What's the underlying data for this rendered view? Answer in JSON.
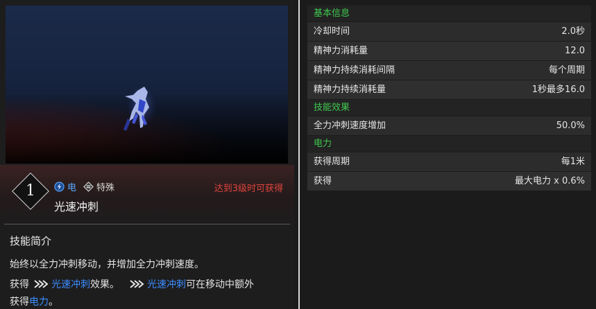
{
  "skill": {
    "level": "1",
    "tags": [
      {
        "label": "电",
        "icon": "lightning-icon",
        "color": "#5aa9ff"
      },
      {
        "label": "特殊",
        "icon": "special-icon"
      }
    ],
    "name": "光速冲刺",
    "unlock_text": "达到3级时可获得"
  },
  "intro": {
    "title": "技能简介",
    "line1": "始终以全力冲刺移动，并增加全力冲刺速度。",
    "line2_prefix": "获得",
    "line2_link1": "光速冲刺",
    "line2_mid": "效果。",
    "line2_link2": "光速冲刺",
    "line2_suffix": "可在移动中额外",
    "line3_prefix": "获得",
    "line3_link": "电力",
    "line3_suffix": "。"
  },
  "sections": [
    {
      "title": "基本信息",
      "rows": [
        {
          "label": "冷却时间",
          "value": "2.0秒"
        },
        {
          "label": "精神力消耗量",
          "value": "12.0"
        },
        {
          "label": "精神力持续消耗间隔",
          "value": "每个周期"
        },
        {
          "label": "精神力持续消耗量",
          "value": "1秒最多16.0"
        }
      ]
    },
    {
      "title": "技能效果",
      "rows": [
        {
          "label": "全力冲刺速度增加",
          "value": "50.0%"
        }
      ]
    },
    {
      "title": "电力",
      "rows": [
        {
          "label": "获得周期",
          "value": "每1米"
        },
        {
          "label": "获得",
          "value": "最大电力 x 0.6%"
        }
      ]
    }
  ],
  "colors": {
    "section_title": "#3fc84f",
    "highlight": "#3d8dff",
    "unlock": "#e0443c"
  }
}
